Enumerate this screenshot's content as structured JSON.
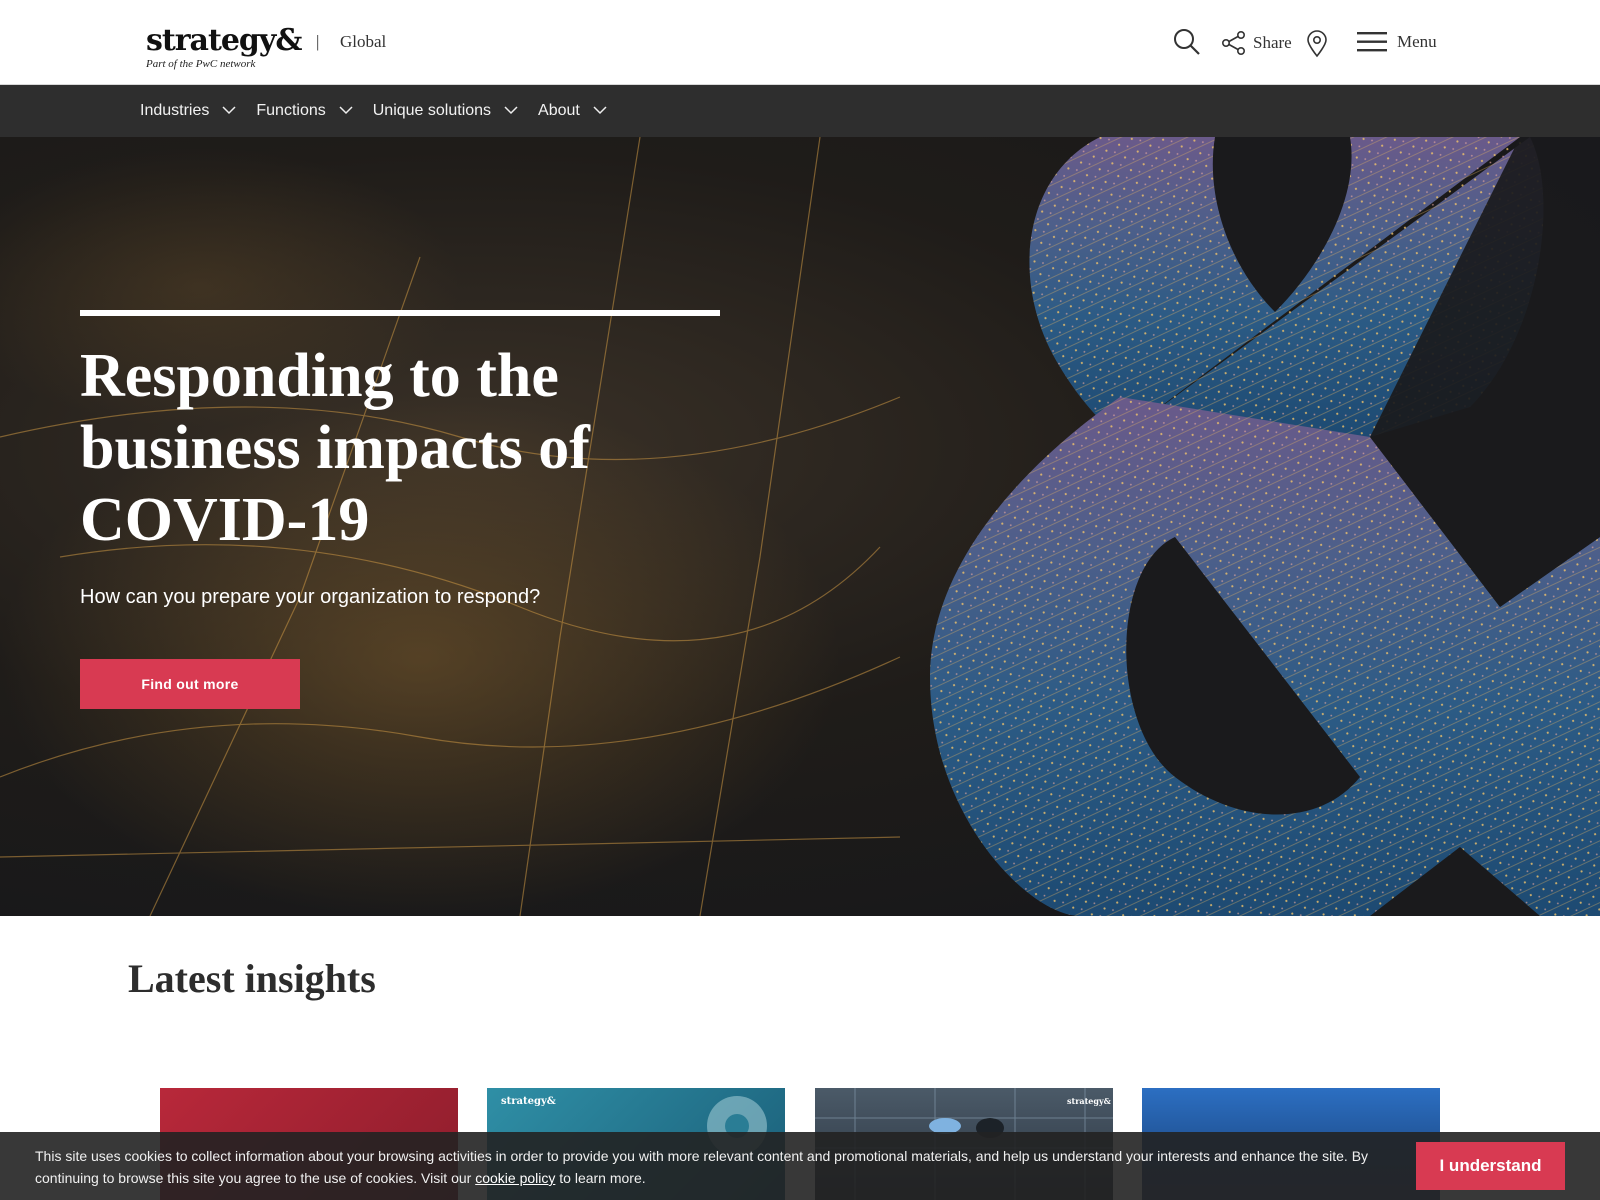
{
  "header": {
    "logo_text": "strategy&",
    "logo_tagline": "Part of the PwC network",
    "divider": "|",
    "region": "Global",
    "tools": {
      "search_icon": "search-icon",
      "share_icon": "share-icon",
      "share_label": "Share",
      "location_icon": "location-pin-icon",
      "menu_icon": "hamburger-icon",
      "menu_label": "Menu"
    }
  },
  "nav": {
    "items": [
      {
        "label": "Industries"
      },
      {
        "label": "Functions"
      },
      {
        "label": "Unique solutions"
      },
      {
        "label": "About"
      }
    ],
    "chevron_icon": "chevron-down-icon"
  },
  "hero": {
    "title": "Responding to the business impacts of COVID-19",
    "subtitle": "How can you prepare your organization to respond?",
    "cta_label": "Find out more"
  },
  "insights": {
    "heading": "Latest insights",
    "cards": [
      {
        "tag": ""
      },
      {
        "tag": "strategy&"
      },
      {
        "tag": "strategy&"
      },
      {
        "tag": ""
      }
    ]
  },
  "cookie_banner": {
    "text_before": "This site uses cookies to collect information about your browsing activities in order to provide you with more relevant content and promotional materials, and help us understand your interests and enhance the site. By continuing to browse this site you agree to the use of cookies. Visit our ",
    "link_text": "cookie policy",
    "text_after": " to learn more.",
    "accept_label": "I understand"
  },
  "colors": {
    "accent": "#d83a52",
    "nav_bg": "#2e2e2e",
    "header_bg": "#ffffff"
  }
}
